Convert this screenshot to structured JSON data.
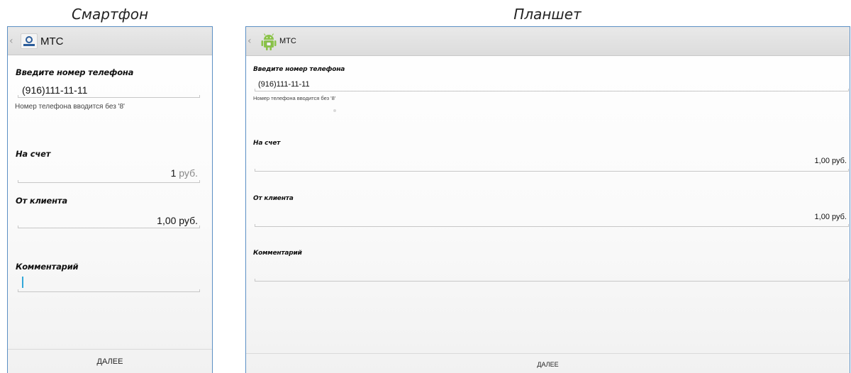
{
  "captions": {
    "phone": "Смартфон",
    "tablet": "Планшет"
  },
  "phone": {
    "app_title": "МТС",
    "phone_label": "Введите номер телефона",
    "phone_value": "(916)111-11-11",
    "phone_hint": "Номер телефона вводится без '8'",
    "account_label": "На счет",
    "account_amount": "1",
    "account_unit": "руб.",
    "client_label": "От клиента",
    "client_amount": "1,00 руб.",
    "comment_label": "Комментарий",
    "comment_value": "",
    "next_button": "ДАЛЕЕ"
  },
  "tablet": {
    "app_title": "МТС",
    "phone_label": "Введите номер телефона",
    "phone_value": "(916)111-11-11",
    "phone_hint": "Номер телефона вводится без '8'",
    "account_label": "На счет",
    "account_amount": "1,00 руб.",
    "client_label": "От клиента",
    "client_amount": "1,00 руб.",
    "comment_label": "Комментарий",
    "comment_value": "",
    "next_button": "ДАЛЕЕ"
  },
  "icons": {
    "back": "chevron-left-icon",
    "phone_app": "mts-logo-icon",
    "tablet_app": "android-robot-icon"
  },
  "colors": {
    "frame_border": "#5b8fc4",
    "action_bar": "#dcdcdc",
    "cursor": "#33a8d9",
    "android_green": "#8bc34a"
  }
}
